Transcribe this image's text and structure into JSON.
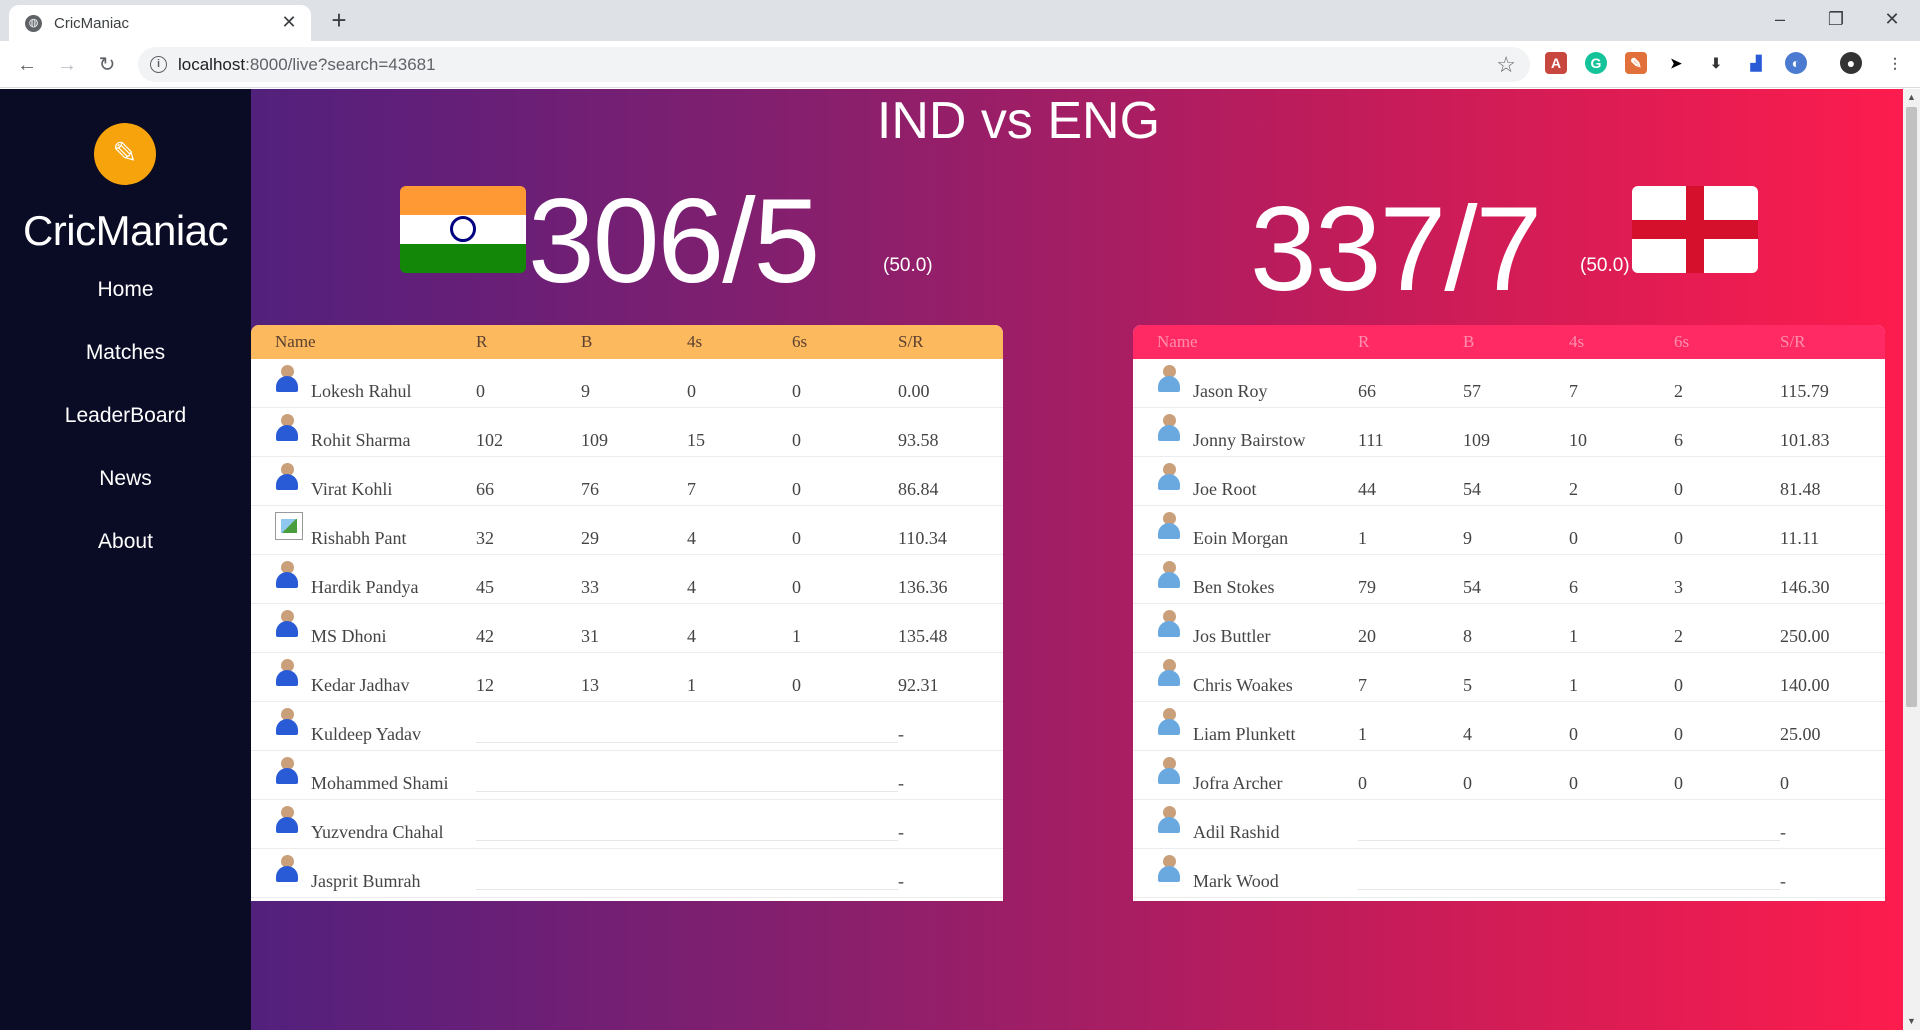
{
  "browser": {
    "tab_title": "CricManiac",
    "url_host": "localhost",
    "url_rest": ":8000/live?search=43681"
  },
  "sidebar": {
    "brand": "CricManiac",
    "nav": [
      "Home",
      "Matches",
      "LeaderBoard",
      "News",
      "About"
    ]
  },
  "match": {
    "title": "IND vs ENG",
    "team1": {
      "score": "306/5",
      "overs": "(50.0)"
    },
    "team2": {
      "score": "337/7",
      "overs": "(50.0)"
    }
  },
  "scorecard": {
    "headers": [
      "Name",
      "R",
      "B",
      "4s",
      "6s",
      "S/R"
    ],
    "team1_rows": [
      [
        "Lokesh Rahul",
        "0",
        "9",
        "0",
        "0",
        "0.00"
      ],
      [
        "Rohit Sharma",
        "102",
        "109",
        "15",
        "0",
        "93.58"
      ],
      [
        "Virat Kohli",
        "66",
        "76",
        "7",
        "0",
        "86.84"
      ],
      [
        "Rishabh Pant",
        "32",
        "29",
        "4",
        "0",
        "110.34"
      ],
      [
        "Hardik Pandya",
        "45",
        "33",
        "4",
        "0",
        "136.36"
      ],
      [
        "MS Dhoni",
        "42",
        "31",
        "4",
        "1",
        "135.48"
      ],
      [
        "Kedar Jadhav",
        "12",
        "13",
        "1",
        "0",
        "92.31"
      ],
      [
        "Kuldeep Yadav",
        "",
        "",
        "",
        "",
        "-"
      ],
      [
        "Mohammed Shami",
        "",
        "",
        "",
        "",
        "-"
      ],
      [
        "Yuzvendra Chahal",
        "",
        "",
        "",
        "",
        "-"
      ],
      [
        "Jasprit Bumrah",
        "",
        "",
        "",
        "",
        "-"
      ]
    ],
    "team2_rows": [
      [
        "Jason Roy",
        "66",
        "57",
        "7",
        "2",
        "115.79"
      ],
      [
        "Jonny Bairstow",
        "111",
        "109",
        "10",
        "6",
        "101.83"
      ],
      [
        "Joe Root",
        "44",
        "54",
        "2",
        "0",
        "81.48"
      ],
      [
        "Eoin Morgan",
        "1",
        "9",
        "0",
        "0",
        "11.11"
      ],
      [
        "Ben Stokes",
        "79",
        "54",
        "6",
        "3",
        "146.30"
      ],
      [
        "Jos Buttler",
        "20",
        "8",
        "1",
        "2",
        "250.00"
      ],
      [
        "Chris Woakes",
        "7",
        "5",
        "1",
        "0",
        "140.00"
      ],
      [
        "Liam Plunkett",
        "1",
        "4",
        "0",
        "0",
        "25.00"
      ],
      [
        "Jofra Archer",
        "0",
        "0",
        "0",
        "0",
        "0"
      ],
      [
        "Adil Rashid",
        "",
        "",
        "",
        "",
        "-"
      ],
      [
        "Mark Wood",
        "",
        "",
        "",
        "",
        "-"
      ]
    ]
  },
  "colors": {
    "team1_header": "#fdb95e",
    "team1_header_text": "#5a4030",
    "team2_header": "#ff2a63",
    "team2_header_text": "#ff8fae",
    "team1_jersey": "#2a5bd7",
    "team2_jersey": "#6aa9e0"
  },
  "icons": {
    "favicon": "globe-icon",
    "logo": "cricket-bat-icon",
    "avatar": "player-photo-icon",
    "broken": "broken-image-icon"
  }
}
